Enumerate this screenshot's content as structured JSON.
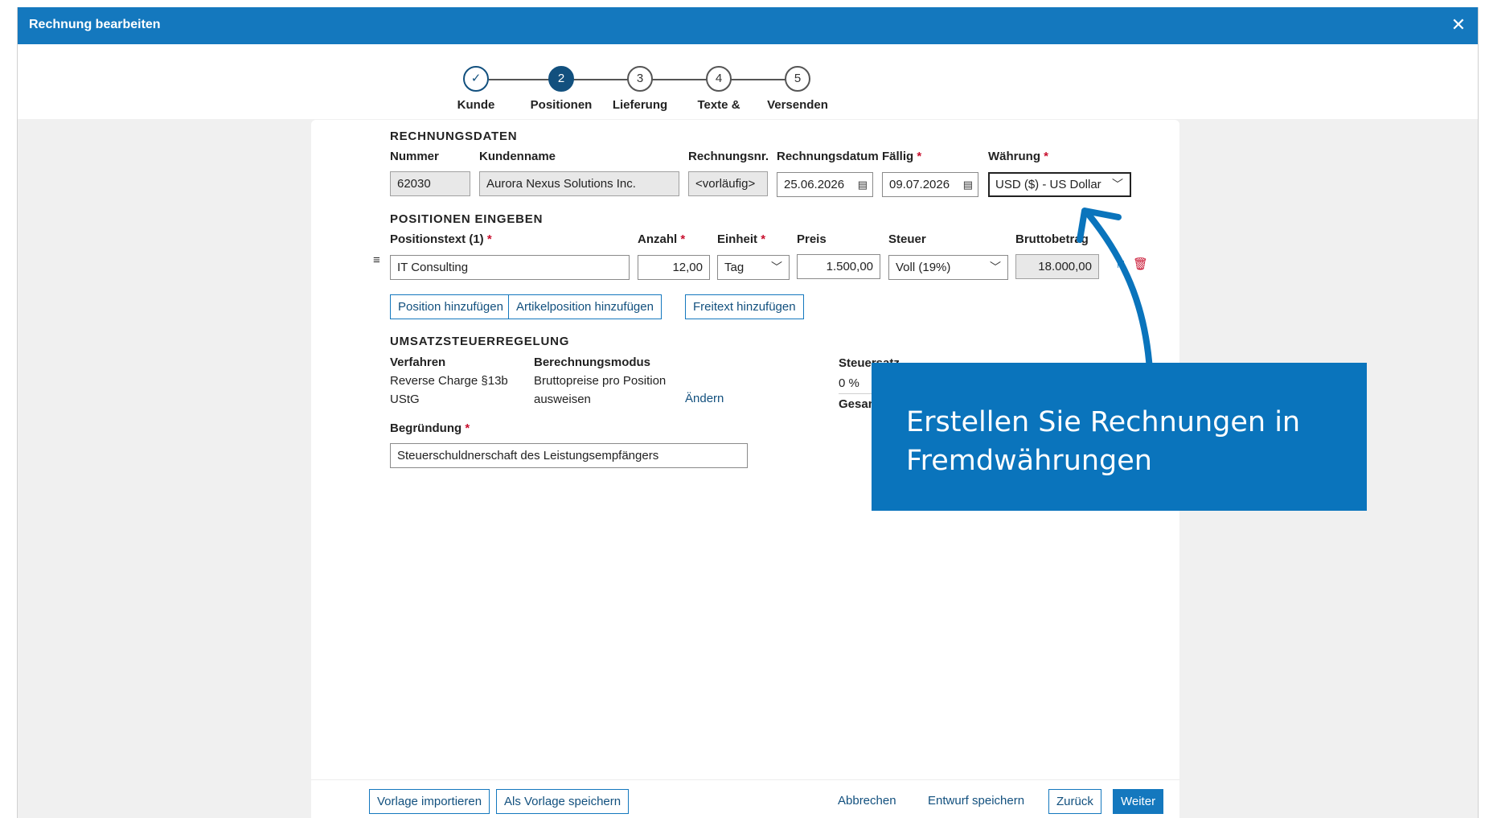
{
  "window": {
    "title": "Rechnung bearbeiten",
    "close_icon": "close-icon"
  },
  "stepper": {
    "steps": [
      {
        "number": "",
        "label": "Kunde",
        "state": "done"
      },
      {
        "number": "2",
        "label": "Positionen",
        "state": "active"
      },
      {
        "number": "3",
        "label": "Lieferung",
        "state": "pending"
      },
      {
        "number": "4",
        "label": "Texte &",
        "state": "pending"
      },
      {
        "number": "5",
        "label": "Versenden",
        "state": "pending"
      }
    ]
  },
  "rechnungsdaten": {
    "section_title": "RECHNUNGSDATEN",
    "nummer_label": "Nummer",
    "nummer_value": "62030",
    "kundenname_label": "Kundenname",
    "kundenname_value": "Aurora Nexus Solutions Inc.",
    "rechnungsnr_label": "Rechnungsnr.",
    "rechnungsnr_value": "<vorläufig>",
    "rechnungsdatum_label": "Rechnungsdatum",
    "rechnungsdatum_value": "25.06.2026",
    "faellig_label": "Fällig",
    "faellig_value": "09.07.2026",
    "waehrung_label": "Währung",
    "waehrung_value": "USD ($) - US Dollar",
    "required_mark": "*"
  },
  "positionen": {
    "section_title": "POSITIONEN EINGEBEN",
    "columns": {
      "positionstext": "Positionstext (1)",
      "anzahl": "Anzahl",
      "einheit": "Einheit",
      "preis": "Preis",
      "steuer": "Steuer",
      "bruttobetrag": "Bruttobetrag"
    },
    "row": {
      "positionstext": "IT Consulting",
      "anzahl": "12,00",
      "einheit": "Tag",
      "preis": "1.500,00",
      "steuer": "Voll (19%)",
      "bruttobetrag": "18.000,00"
    },
    "buttons": {
      "add_position": "Position hinzufügen",
      "add_article": "Artikelposition hinzufügen",
      "add_freetext": "Freitext hinzufügen"
    }
  },
  "umsatzsteuer": {
    "section_title": "UMSATZSTEUERREGELUNG",
    "verfahren_label": "Verfahren",
    "verfahren_value": "Reverse Charge §13b UStG",
    "berechnungsmodus_label": "Berechnungsmodus",
    "berechnungsmodus_value": "Bruttopreise pro Position ausweisen",
    "aendern_link": "Ändern",
    "summary": {
      "steuersatz_header": "Steuersatz",
      "rate_value": "0 %",
      "gesamt_label": "Gesamt"
    },
    "begruendung_label": "Begründung",
    "begruendung_value": "Steuerschuldnerschaft des Leistungsempfängers"
  },
  "footer": {
    "vorlage_importieren": "Vorlage importieren",
    "als_vorlage_speichern": "Als Vorlage speichern",
    "abbrechen": "Abbrechen",
    "entwurf_speichern": "Entwurf speichern",
    "zurueck": "Zurück",
    "weiter": "Weiter"
  },
  "callout": {
    "text": "Erstellen Sie Rechnungen in Fremdwährungen",
    "color": "#0a74bc"
  },
  "colors": {
    "titlebar": "#1478be",
    "primary_dark": "#12507e",
    "required": "#c8102e"
  }
}
